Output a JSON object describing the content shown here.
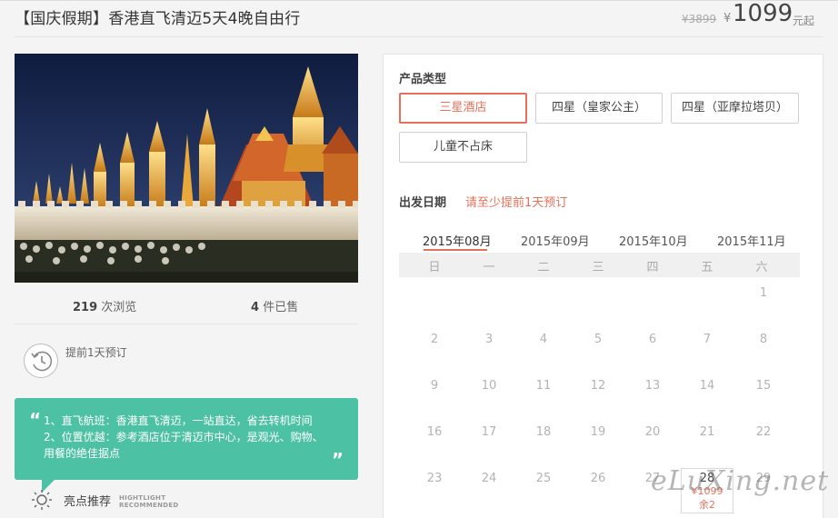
{
  "header": {
    "title": "【国庆假期】香港直飞清迈5天4晚自由行",
    "old_price": "¥3899",
    "currency": "¥",
    "price": "1099",
    "price_unit": "元起"
  },
  "stats": {
    "views_num": "219",
    "views_label": "次浏览",
    "sold_num": "4",
    "sold_label": "件已售"
  },
  "booking": {
    "icon": "clock-icon",
    "text": "提前1天预订"
  },
  "highlights": {
    "quote_open": "“",
    "quote_close": "”",
    "lines": [
      "1、直飞航班：香港直飞清迈，一站直达，省去转机时间",
      "2、位置优越：参考酒店位于清迈市中心，是观光、购物、",
      "用餐的绝佳据点"
    ],
    "footer_label": "亮点推荐",
    "footer_en_1": "HIGHTLIGHT",
    "footer_en_2": "RECOMMENDED",
    "footer_icon": "sun-icon",
    "color": "#4cc1a3"
  },
  "product": {
    "label": "产品类型",
    "options": [
      "三星酒店",
      "四星（皇家公主）",
      "四星（亚摩拉塔贝）",
      "儿童不占床"
    ],
    "selected": "三星酒店"
  },
  "departure": {
    "label": "出发日期",
    "hint": "请至少提前1天预订",
    "months": [
      "2015年08月",
      "2015年09月",
      "2015年10月",
      "2015年11月"
    ],
    "active_month": "2015年08月",
    "weekdays": [
      "日",
      "一",
      "二",
      "三",
      "四",
      "五",
      "六"
    ],
    "weeks": [
      [
        "",
        "",
        "",
        "",
        "",
        "",
        "1"
      ],
      [
        "2",
        "3",
        "4",
        "5",
        "6",
        "7",
        "8"
      ],
      [
        "9",
        "10",
        "11",
        "12",
        "13",
        "14",
        "15"
      ],
      [
        "16",
        "17",
        "18",
        "19",
        "20",
        "21",
        "22"
      ],
      [
        "23",
        "24",
        "25",
        "26",
        "27",
        "28",
        "29"
      ]
    ],
    "available": {
      "day": "28",
      "price": "¥1099",
      "remaining": "余2"
    }
  },
  "watermark": "eLuXing.net",
  "colors": {
    "accent": "#e8705a",
    "teal": "#4cc1a3"
  }
}
